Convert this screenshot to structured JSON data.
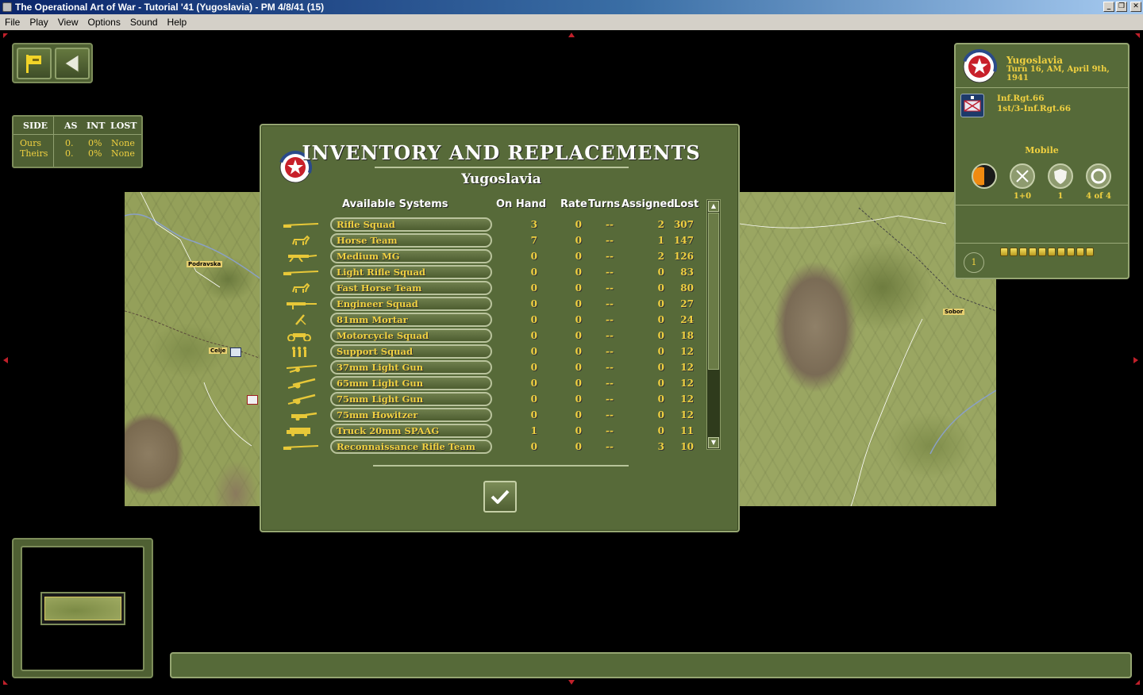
{
  "window": {
    "title": "The Operational Art of War - Tutorial '41 (Yugoslavia) - PM 4/8/41 (15)",
    "buttons": [
      "_",
      "❐",
      "✕"
    ]
  },
  "menu": [
    "File",
    "Play",
    "View",
    "Options",
    "Sound",
    "Help"
  ],
  "side_table": {
    "headers": [
      "SIDE",
      "AS",
      "INT",
      "LOST"
    ],
    "rows": [
      {
        "side": "Ours",
        "as": "0.",
        "int": "0%",
        "lost": "None"
      },
      {
        "side": "Theirs",
        "as": "0.",
        "int": "0%",
        "lost": "None"
      }
    ]
  },
  "map": {
    "towns": [
      "Podravska",
      "Celje",
      "Sobor"
    ]
  },
  "dialog": {
    "title": "INVENTORY AND REPLACEMENTS",
    "subtitle": "Yugoslavia",
    "columns": [
      "Available Systems",
      "On Hand",
      "Rate",
      "Turns",
      "Assigned",
      "Lost"
    ],
    "rows": [
      {
        "name": "Rifle Squad",
        "icon": "rifle-icon",
        "on_hand": "3",
        "rate": "0",
        "turns": "--",
        "assigned": "2",
        "lost": "307"
      },
      {
        "name": "Horse Team",
        "icon": "horse-icon",
        "on_hand": "7",
        "rate": "0",
        "turns": "--",
        "assigned": "1",
        "lost": "147"
      },
      {
        "name": "Medium MG",
        "icon": "machine-gun-icon",
        "on_hand": "0",
        "rate": "0",
        "turns": "--",
        "assigned": "2",
        "lost": "126"
      },
      {
        "name": "Light Rifle Squad",
        "icon": "rifle-icon",
        "on_hand": "0",
        "rate": "0",
        "turns": "--",
        "assigned": "0",
        "lost": "83"
      },
      {
        "name": "Fast Horse Team",
        "icon": "horse-icon",
        "on_hand": "0",
        "rate": "0",
        "turns": "--",
        "assigned": "0",
        "lost": "80"
      },
      {
        "name": "Engineer Squad",
        "icon": "engineer-icon",
        "on_hand": "0",
        "rate": "0",
        "turns": "--",
        "assigned": "0",
        "lost": "27"
      },
      {
        "name": "81mm Mortar",
        "icon": "mortar-icon",
        "on_hand": "0",
        "rate": "0",
        "turns": "--",
        "assigned": "0",
        "lost": "24"
      },
      {
        "name": "Motorcycle Squad",
        "icon": "motorcycle-icon",
        "on_hand": "0",
        "rate": "0",
        "turns": "--",
        "assigned": "0",
        "lost": "18"
      },
      {
        "name": "Support Squad",
        "icon": "soldiers-icon",
        "on_hand": "0",
        "rate": "0",
        "turns": "--",
        "assigned": "0",
        "lost": "12"
      },
      {
        "name": "37mm Light Gun",
        "icon": "light-gun-icon",
        "on_hand": "0",
        "rate": "0",
        "turns": "--",
        "assigned": "0",
        "lost": "12"
      },
      {
        "name": "65mm Light Gun",
        "icon": "field-gun-icon",
        "on_hand": "0",
        "rate": "0",
        "turns": "--",
        "assigned": "0",
        "lost": "12"
      },
      {
        "name": "75mm Light Gun",
        "icon": "field-gun-icon",
        "on_hand": "0",
        "rate": "0",
        "turns": "--",
        "assigned": "0",
        "lost": "12"
      },
      {
        "name": "75mm Howitzer",
        "icon": "howitzer-icon",
        "on_hand": "0",
        "rate": "0",
        "turns": "--",
        "assigned": "0",
        "lost": "12"
      },
      {
        "name": "Truck 20mm SPAAG",
        "icon": "truck-icon",
        "on_hand": "1",
        "rate": "0",
        "turns": "--",
        "assigned": "0",
        "lost": "11"
      },
      {
        "name": "Reconnaissance Rifle Team",
        "icon": "rifle-icon",
        "on_hand": "0",
        "rate": "0",
        "turns": "--",
        "assigned": "3",
        "lost": "10"
      }
    ]
  },
  "info_panel": {
    "nation": "Yugoslavia",
    "turn": "Turn 16, AM, April 9th, 1941",
    "unit_name": "Inf.Rgt.66",
    "unit_sub": "1st/3-Inf.Rgt.66",
    "mode": "Mobile",
    "stats": [
      {
        "icon": "readiness-icon",
        "label": ""
      },
      {
        "icon": "attack-swords-icon",
        "label": "1+0"
      },
      {
        "icon": "defense-shield-icon",
        "label": "1"
      },
      {
        "icon": "movement-ring-icon",
        "label": "4 of 4"
      }
    ],
    "level": "1",
    "pips": 10
  },
  "colors": {
    "panel": "#566a39",
    "border": "#96a672",
    "gold": "#f0d040"
  }
}
